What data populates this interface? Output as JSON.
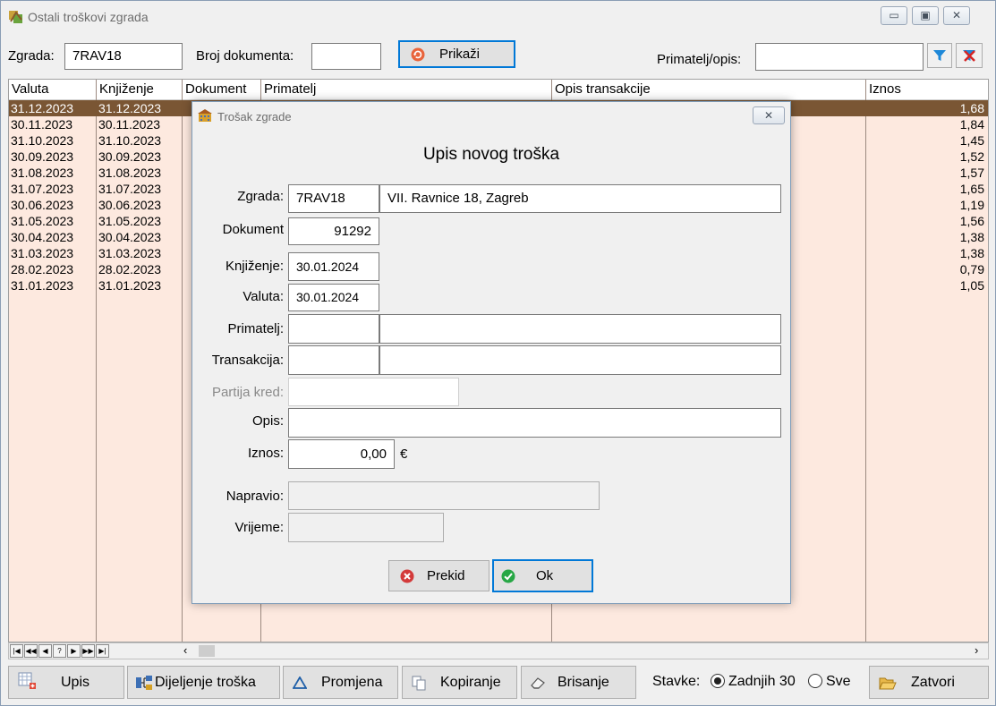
{
  "window": {
    "title": "Ostali troškovi zgrada"
  },
  "filter": {
    "zgrada_label": "Zgrada:",
    "zgrada_value": "7RAV18",
    "broj_label": "Broj dokumenta:",
    "broj_value": "",
    "prikazi_label": "Prikaži",
    "primatelj_label": "Primatelj/opis:",
    "primatelj_value": ""
  },
  "grid": {
    "columns": [
      "Valuta",
      "Knjiženje",
      "Dokument",
      "Primatelj",
      "Opis transakcije",
      "Iznos"
    ],
    "rows": [
      {
        "valuta": "31.12.2023",
        "knjizenje": "31.12.2023",
        "iznos": "1,68",
        "selected": true
      },
      {
        "valuta": "30.11.2023",
        "knjizenje": "30.11.2023",
        "iznos": "1,84"
      },
      {
        "valuta": "31.10.2023",
        "knjizenje": "31.10.2023",
        "iznos": "1,45"
      },
      {
        "valuta": "30.09.2023",
        "knjizenje": "30.09.2023",
        "iznos": "1,52"
      },
      {
        "valuta": "31.08.2023",
        "knjizenje": "31.08.2023",
        "iznos": "1,57"
      },
      {
        "valuta": "31.07.2023",
        "knjizenje": "31.07.2023",
        "iznos": "1,65"
      },
      {
        "valuta": "30.06.2023",
        "knjizenje": "30.06.2023",
        "iznos": "1,19"
      },
      {
        "valuta": "31.05.2023",
        "knjizenje": "31.05.2023",
        "iznos": "1,56"
      },
      {
        "valuta": "30.04.2023",
        "knjizenje": "30.04.2023",
        "iznos": "1,38"
      },
      {
        "valuta": "31.03.2023",
        "knjizenje": "31.03.2023",
        "iznos": "1,38"
      },
      {
        "valuta": "28.02.2023",
        "knjizenje": "28.02.2023",
        "iznos": "0,79"
      },
      {
        "valuta": "31.01.2023",
        "knjizenje": "31.01.2023",
        "iznos": "1,05"
      }
    ]
  },
  "nav": {
    "buttons": [
      "|◀",
      "◀◀",
      "◀",
      "?",
      "▶",
      "▶▶",
      "▶|"
    ]
  },
  "bottom": {
    "upis": "Upis",
    "dijeljenje": "Dijeljenje troška",
    "promjena": "Promjena",
    "kopiranje": "Kopiranje",
    "brisanje": "Brisanje",
    "stavke_label": "Stavke:",
    "opt_zadnjih": "Zadnjih 30",
    "opt_sve": "Sve",
    "zatvori": "Zatvori"
  },
  "dialog": {
    "title": "Trošak zgrade",
    "heading": "Upis novog troška",
    "zgrada_label": "Zgrada:",
    "zgrada_code": "7RAV18",
    "zgrada_name": "VII. Ravnice 18, Zagreb",
    "dokument_label": "Dokument",
    "dokument_value": "91292",
    "knjizenje_label": "Knjiženje:",
    "knjizenje_value": "30.01.2024",
    "valuta_label": "Valuta:",
    "valuta_value": "30.01.2024",
    "primatelj_label": "Primatelj:",
    "transakcija_label": "Transakcija:",
    "partija_label": "Partija kred:",
    "opis_label": "Opis:",
    "iznos_label": "Iznos:",
    "iznos_value": "0,00",
    "currency": "€",
    "napravio_label": "Napravio:",
    "vrijeme_label": "Vrijeme:",
    "prekid": "Prekid",
    "ok": "Ok"
  }
}
